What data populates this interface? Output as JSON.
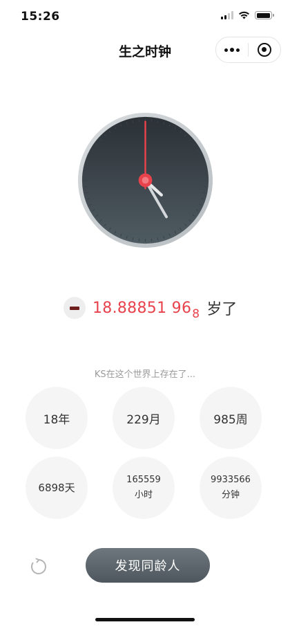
{
  "status_bar": {
    "time": "15:26"
  },
  "nav": {
    "title": "生之时钟"
  },
  "clock": {
    "hour": 4,
    "minute": 25,
    "second": 0
  },
  "age": {
    "value": "18.88851 96",
    "extra_digit": "8",
    "unit": "岁了"
  },
  "stats": {
    "subtitle": "KS在这个世界上存在了...",
    "items": [
      {
        "line1": "18年",
        "line2": ""
      },
      {
        "line1": "229月",
        "line2": ""
      },
      {
        "line1": "985周",
        "line2": ""
      },
      {
        "line1": "6898天",
        "line2": ""
      },
      {
        "line1": "165559",
        "line2": "小时"
      },
      {
        "line1": "9933566",
        "line2": "分钟"
      }
    ]
  },
  "actions": {
    "find_label": "发现同龄人"
  },
  "colors": {
    "accent": "#e8434c",
    "button": "#5d666c",
    "stat_bg": "#f5f5f5"
  }
}
